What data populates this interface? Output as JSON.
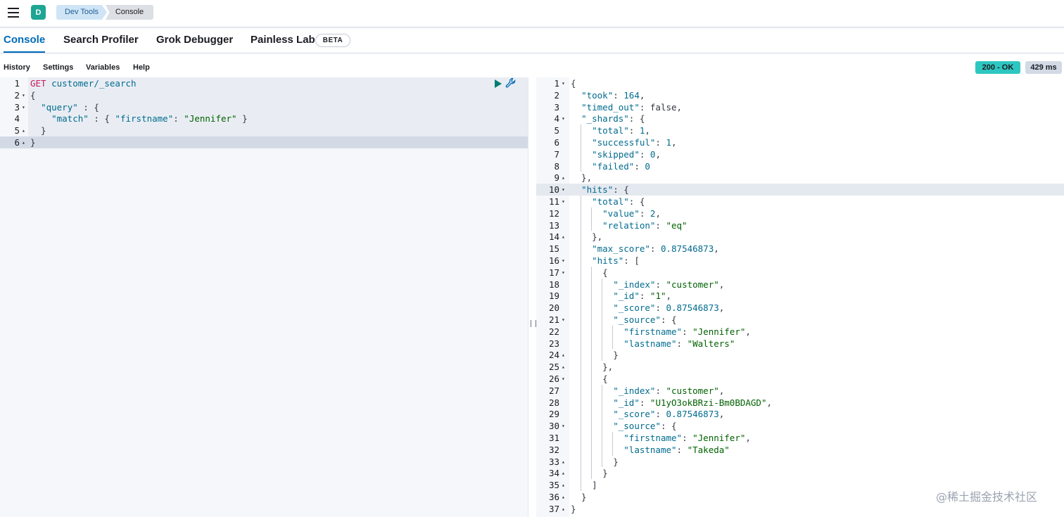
{
  "header": {
    "avatar_letter": "D",
    "breadcrumbs": [
      "Dev Tools",
      "Console"
    ]
  },
  "tabs": [
    {
      "label": "Console",
      "active": true
    },
    {
      "label": "Search Profiler",
      "active": false
    },
    {
      "label": "Grok Debugger",
      "active": false
    },
    {
      "label": "Painless Lab",
      "active": false
    }
  ],
  "beta_badge": "BETA",
  "toolbar": {
    "history": "History",
    "settings": "Settings",
    "variables": "Variables",
    "help": "Help"
  },
  "status": {
    "code": "200 - OK",
    "time": "429 ms",
    "code_color": "#2ec6c1"
  },
  "request": {
    "method": "GET",
    "path": "customer/_search",
    "lines": [
      {
        "num": "1",
        "fold": "",
        "indent": 0,
        "text": ""
      },
      {
        "num": "2",
        "fold": "down",
        "indent": 0,
        "text": "{"
      },
      {
        "num": "3",
        "fold": "down",
        "indent": 1,
        "text": "\"query\" : {"
      },
      {
        "num": "4",
        "fold": "",
        "indent": 2,
        "text": "\"match\" : { \"firstname\": \"Jennifer\" }"
      },
      {
        "num": "5",
        "fold": "up",
        "indent": 1,
        "text": "}"
      },
      {
        "num": "6",
        "fold": "up",
        "indent": 0,
        "text": "}"
      }
    ]
  },
  "response": {
    "lines": [
      {
        "num": "1",
        "fold": "down",
        "text": "{"
      },
      {
        "num": "2",
        "fold": "",
        "text": "  \"took\": 164,"
      },
      {
        "num": "3",
        "fold": "",
        "text": "  \"timed_out\": false,"
      },
      {
        "num": "4",
        "fold": "down",
        "text": "  \"_shards\": {"
      },
      {
        "num": "5",
        "fold": "",
        "text": "    \"total\": 1,"
      },
      {
        "num": "6",
        "fold": "",
        "text": "    \"successful\": 1,"
      },
      {
        "num": "7",
        "fold": "",
        "text": "    \"skipped\": 0,"
      },
      {
        "num": "8",
        "fold": "",
        "text": "    \"failed\": 0"
      },
      {
        "num": "9",
        "fold": "up",
        "text": "  },"
      },
      {
        "num": "10",
        "fold": "down",
        "text": "  \"hits\": {"
      },
      {
        "num": "11",
        "fold": "down",
        "text": "    \"total\": {"
      },
      {
        "num": "12",
        "fold": "",
        "text": "      \"value\": 2,"
      },
      {
        "num": "13",
        "fold": "",
        "text": "      \"relation\": \"eq\""
      },
      {
        "num": "14",
        "fold": "up",
        "text": "    },"
      },
      {
        "num": "15",
        "fold": "",
        "text": "    \"max_score\": 0.87546873,"
      },
      {
        "num": "16",
        "fold": "down",
        "text": "    \"hits\": ["
      },
      {
        "num": "17",
        "fold": "down",
        "text": "      {"
      },
      {
        "num": "18",
        "fold": "",
        "text": "        \"_index\": \"customer\","
      },
      {
        "num": "19",
        "fold": "",
        "text": "        \"_id\": \"1\","
      },
      {
        "num": "20",
        "fold": "",
        "text": "        \"_score\": 0.87546873,"
      },
      {
        "num": "21",
        "fold": "down",
        "text": "        \"_source\": {"
      },
      {
        "num": "22",
        "fold": "",
        "text": "          \"firstname\": \"Jennifer\","
      },
      {
        "num": "23",
        "fold": "",
        "text": "          \"lastname\": \"Walters\""
      },
      {
        "num": "24",
        "fold": "up",
        "text": "        }"
      },
      {
        "num": "25",
        "fold": "up",
        "text": "      },"
      },
      {
        "num": "26",
        "fold": "down",
        "text": "      {"
      },
      {
        "num": "27",
        "fold": "",
        "text": "        \"_index\": \"customer\","
      },
      {
        "num": "28",
        "fold": "",
        "text": "        \"_id\": \"U1yO3okBRzi-Bm0BDAGD\","
      },
      {
        "num": "29",
        "fold": "",
        "text": "        \"_score\": 0.87546873,"
      },
      {
        "num": "30",
        "fold": "down",
        "text": "        \"_source\": {"
      },
      {
        "num": "31",
        "fold": "",
        "text": "          \"firstname\": \"Jennifer\","
      },
      {
        "num": "32",
        "fold": "",
        "text": "          \"lastname\": \"Takeda\""
      },
      {
        "num": "33",
        "fold": "up",
        "text": "        }"
      },
      {
        "num": "34",
        "fold": "up",
        "text": "      }"
      },
      {
        "num": "35",
        "fold": "up",
        "text": "    ]"
      },
      {
        "num": "36",
        "fold": "up",
        "text": "  }"
      },
      {
        "num": "37",
        "fold": "up",
        "text": "}"
      }
    ]
  },
  "watermark": "@稀土掘金技术社区",
  "icons": {
    "menu": "hamburger-menu-icon",
    "run": "play-icon",
    "request_options": "wrench-icon",
    "fold_down": "caret-down-icon",
    "fold_up": "caret-up-icon"
  }
}
